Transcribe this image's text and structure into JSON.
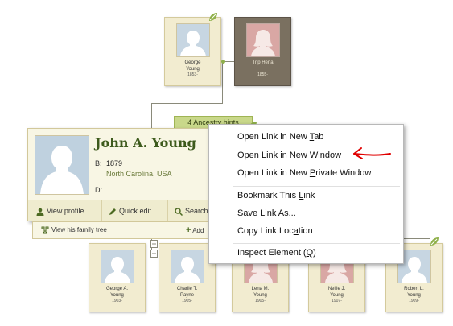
{
  "top_cards": [
    {
      "name_l1": "George",
      "name_l2": "Young",
      "year": "1853-"
    },
    {
      "name_l1": "Trip Hena",
      "name_l2": "",
      "year": "1855-"
    }
  ],
  "ancestry_hints": "4 Ancestry hints",
  "popup": {
    "name": "John A. Young",
    "birth_label": "B:",
    "birth_year": "1879",
    "birth_place": "North Carolina, USA",
    "death_label": "D:",
    "view_profile": "View profile",
    "quick_edit": "Quick edit",
    "search": "Search",
    "family_tree": "View his family tree",
    "add": "Add"
  },
  "context_menu": {
    "open_tab": {
      "pre": "Open Link in New ",
      "key": "T",
      "post": "ab"
    },
    "open_window": {
      "pre": "Open Link in New ",
      "key": "W",
      "post": "indow"
    },
    "open_private": {
      "pre": "Open Link in New ",
      "key": "P",
      "post": "rivate Window"
    },
    "bookmark": {
      "pre": "Bookmark This ",
      "key": "L",
      "post": "ink"
    },
    "save_link": {
      "pre": "Save Lin",
      "key": "k",
      "post": " As..."
    },
    "copy_link": {
      "pre": "Copy Link Loc",
      "key": "a",
      "post": "tion"
    },
    "inspect": {
      "pre": "Inspect Element (",
      "key": "Q",
      "post": ")"
    }
  },
  "child_cards": [
    {
      "name_l1": "George A.",
      "name_l2": "Young",
      "year": "1903-"
    },
    {
      "name_l1": "Charlie T.",
      "name_l2": "Payne",
      "year": "1905-"
    },
    {
      "name_l1": "Lena M.",
      "name_l2": "Young",
      "year": "1905-"
    },
    {
      "name_l1": "Nellie J.",
      "name_l2": "Young",
      "year": "1907-"
    },
    {
      "name_l1": "Robert L.",
      "name_l2": "Young",
      "year": "1909-"
    }
  ],
  "colors": {
    "accent_green": "#3d5a1c",
    "card_bg": "#f2ecd0",
    "annotation_red": "#e00000"
  }
}
